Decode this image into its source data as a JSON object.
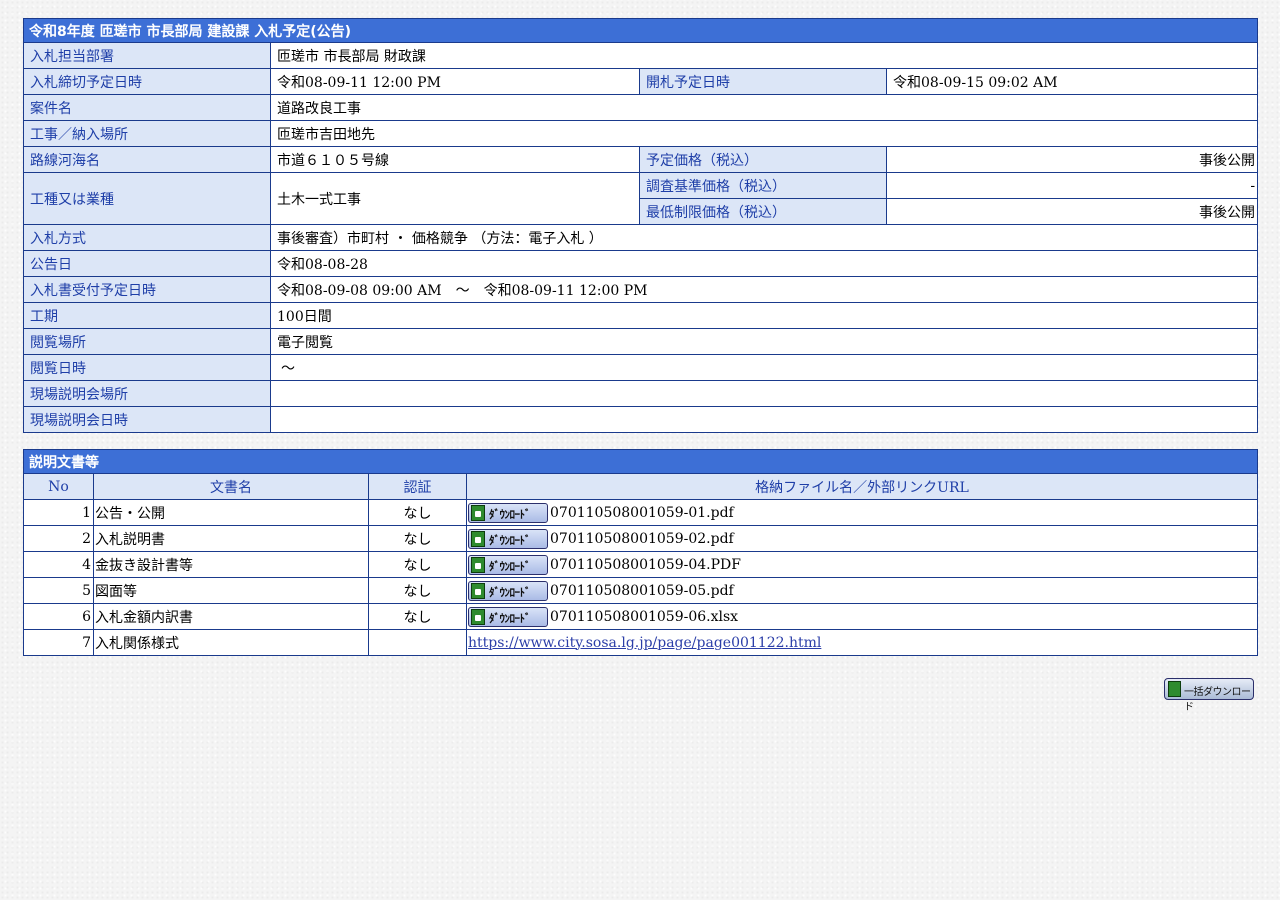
{
  "info": {
    "caption": "令和8年度 匝瑳市 市長部局 建設課 入札予定(公告)",
    "department_label": "入札担当部署",
    "department": "匝瑳市 市長部局 財政課",
    "deadline_label": "入札締切予定日時",
    "deadline": "令和08-09-11 12:00 PM",
    "opening_label": "開札予定日時",
    "opening": "令和08-09-15 09:02 AM",
    "project_label": "案件名",
    "project": "道路改良工事",
    "location_label": "工事／納入場所",
    "location": "匝瑳市吉田地先",
    "route_label": "路線河海名",
    "route": "市道６１０５号線",
    "planned_price_label": "予定価格（税込）",
    "planned_price": "事後公開",
    "work_type_label": "工種又は業種",
    "work_type": "土木一式工事",
    "survey_price_label": "調査基準価格（税込）",
    "survey_price": "-",
    "min_price_label": "最低制限価格（税込）",
    "min_price": "事後公開",
    "method_label": "入札方式",
    "method": "事後審査）市町村 ・ 価格競争 （方法：電子入札 ）",
    "announce_label": "公告日",
    "announce": "令和08-08-28",
    "reception_label": "入札書受付予定日時",
    "reception": "令和08-09-08 09:00 AM　～　令和08-09-11 12:00 PM",
    "period_label": "工期",
    "period": "100日間",
    "viewing_place_label": "閲覧場所",
    "viewing_place": "電子閲覧",
    "viewing_date_label": "閲覧日時",
    "viewing_date": "～",
    "site_place_label": "現場説明会場所",
    "site_place": "",
    "site_date_label": "現場説明会日時",
    "site_date": ""
  },
  "docs": {
    "caption": "説明文書等",
    "headers": {
      "no": "No",
      "name": "文書名",
      "auth": "認証",
      "file": "格納ファイル名／外部リンクURL"
    },
    "download_label": "ﾀﾞｳﾝﾛｰﾄﾞ",
    "rows": [
      {
        "no": "1",
        "name": "公告・公開",
        "auth": "なし",
        "file": "070110508001059-01.pdf"
      },
      {
        "no": "2",
        "name": "入札説明書",
        "auth": "なし",
        "file": "070110508001059-02.pdf"
      },
      {
        "no": "4",
        "name": "金抜き設計書等",
        "auth": "なし",
        "file": "070110508001059-04.PDF"
      },
      {
        "no": "5",
        "name": "図面等",
        "auth": "なし",
        "file": "070110508001059-05.pdf"
      },
      {
        "no": "6",
        "name": "入札金額内訳書",
        "auth": "なし",
        "file": "070110508001059-06.xlsx"
      }
    ],
    "link_row": {
      "no": "7",
      "name": "入札関係様式",
      "auth": "",
      "url": "https://www.city.sosa.lg.jp/page/page001122.html"
    }
  },
  "bulk_download_label": "一括ダウンロード",
  "icons": {
    "download": "floppy-disk-download-icon"
  }
}
